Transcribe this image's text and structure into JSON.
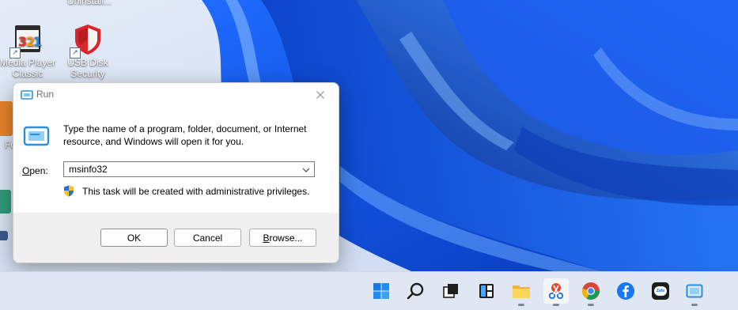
{
  "desktop": {
    "icons": [
      {
        "name": "media-player-classic",
        "label_line1": "Media Player",
        "label_line2": "Classic"
      },
      {
        "name": "usb-disk-security",
        "label_line1": "USB Disk",
        "label_line2": "Security"
      }
    ],
    "partial_top_label": "Uninstall...",
    "partial_left_label": "Fo"
  },
  "run_dialog": {
    "title": "Run",
    "description": "Type the name of a program, folder, document, or Internet resource, and Windows will open it for you.",
    "open_label_prefix": "O",
    "open_label_rest": "pen:",
    "open_value": "msinfo32",
    "admin_note": "This task will be created with administrative privileges.",
    "ok_label": "OK",
    "cancel_label": "Cancel",
    "browse_prefix": "B",
    "browse_rest": "rowse..."
  },
  "taskbar": {
    "items": [
      {
        "name": "start",
        "icon": "windows-logo-icon"
      },
      {
        "name": "search",
        "icon": "search-icon"
      },
      {
        "name": "task-view",
        "icon": "task-view-icon"
      },
      {
        "name": "widgets",
        "icon": "widgets-icon"
      },
      {
        "name": "file-explorer",
        "icon": "folder-icon"
      },
      {
        "name": "snipping-tool",
        "icon": "scissors-icon"
      },
      {
        "name": "chrome",
        "icon": "chrome-icon"
      },
      {
        "name": "facebook",
        "icon": "facebook-icon"
      },
      {
        "name": "zalo",
        "icon": "zalo-icon",
        "text": "Zalo"
      },
      {
        "name": "run",
        "icon": "run-icon"
      }
    ]
  },
  "colors": {
    "wallpaper_bg": "#d7e2f2",
    "accent_blue": "#0a5ae6",
    "taskbar_bg": "#dfe7f3"
  }
}
